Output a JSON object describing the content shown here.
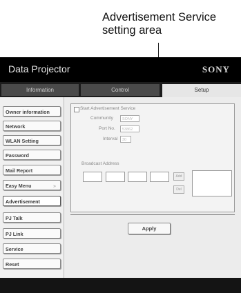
{
  "callout": {
    "line1": "Advertisement Service",
    "line2": "setting area"
  },
  "app": {
    "title": "Data Projector",
    "brand": "SONY"
  },
  "tabs": [
    {
      "label": "Information"
    },
    {
      "label": "Control"
    },
    {
      "label": "Setup",
      "active": true
    }
  ],
  "sidebar": {
    "items": [
      {
        "label": "Owner information"
      },
      {
        "label": "Network"
      },
      {
        "label": "WLAN Setting"
      },
      {
        "label": "Password"
      },
      {
        "label": "Mail Report"
      },
      {
        "label": "Easy Menu",
        "arrow": "»"
      },
      {
        "label": "Advertisement",
        "active": true
      },
      {
        "label": "PJ Talk"
      },
      {
        "label": "PJ Link"
      },
      {
        "label": "Service"
      },
      {
        "label": "Reset"
      }
    ]
  },
  "advertisement": {
    "start_label": "Start Advertisement Service",
    "start_checked": false,
    "community_label": "Community",
    "community_value": "SONY",
    "port_label": "Port No.",
    "port_value": "53862",
    "interval_label": "Interval",
    "interval_value": "30",
    "broadcast_label": "Broadcast Address",
    "add_button": "Add",
    "remove_button": "Del"
  },
  "apply_label": "Apply"
}
